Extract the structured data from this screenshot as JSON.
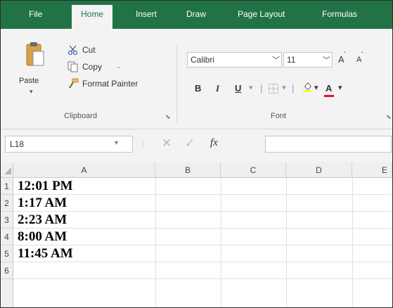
{
  "ribbon_tabs": [
    "File",
    "Home",
    "Insert",
    "Draw",
    "Page Layout",
    "Formulas"
  ],
  "active_tab": "Home",
  "clipboard": {
    "paste_label": "Paste",
    "cut_label": "Cut",
    "copy_label": "Copy",
    "copy_dropdown": "-",
    "format_painter_label": "Format Painter",
    "group_label": "Clipboard"
  },
  "font": {
    "font_name": "Calibri",
    "font_size": "11",
    "grow_font": "A",
    "shrink_font": "A",
    "bold": "B",
    "italic": "I",
    "underline": "U",
    "group_label": "Font"
  },
  "formula_bar": {
    "name_box": "L18",
    "fx_label": "fx",
    "formula_value": ""
  },
  "columns": [
    "A",
    "B",
    "C",
    "D",
    "E"
  ],
  "rows": [
    {
      "num": "1",
      "a": "12:01 PM"
    },
    {
      "num": "2",
      "a": "1:17 AM"
    },
    {
      "num": "3",
      "a": "2:23 AM"
    },
    {
      "num": "4",
      "a": "8:00 AM"
    },
    {
      "num": "5",
      "a": "11:45 AM"
    },
    {
      "num": "6",
      "a": ""
    }
  ],
  "colors": {
    "accent": "#217346",
    "ribbon_bg": "#f3f3f3",
    "font_color_bar": "#e81123",
    "highlight_bar": "#ffff00"
  }
}
